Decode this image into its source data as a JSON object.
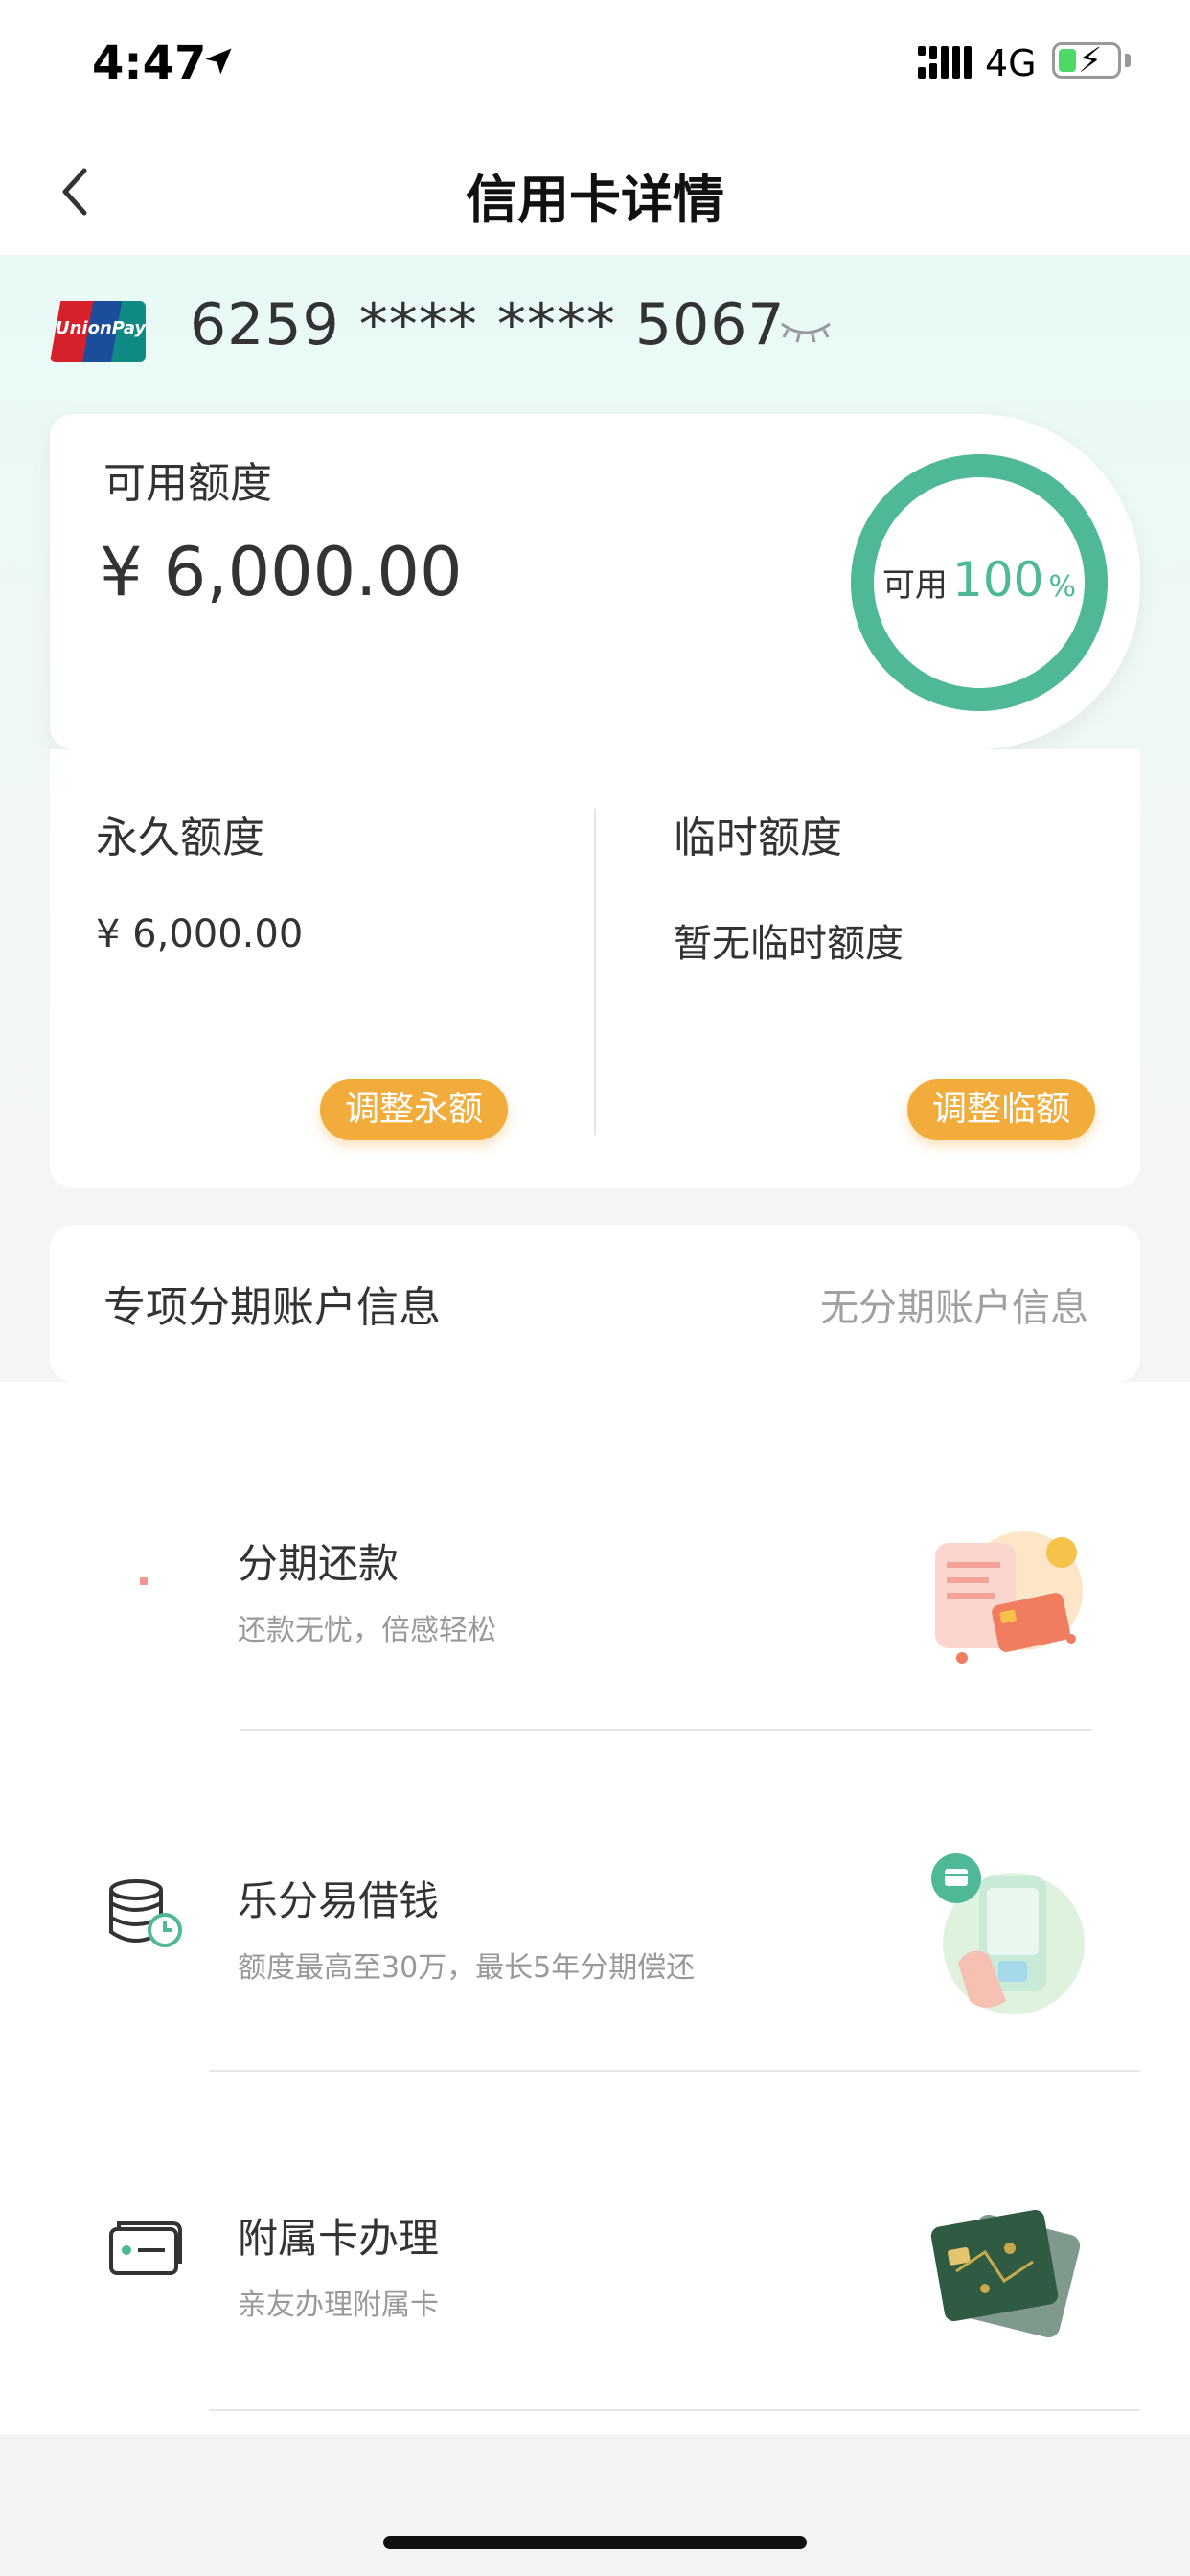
{
  "status_bar": {
    "time": "4:47",
    "network": "4G"
  },
  "nav": {
    "title": "信用卡详情"
  },
  "card": {
    "brand_logo_text": "UnionPay 银联",
    "number_masked": "6259 **** **** 5067"
  },
  "available": {
    "label": "可用额度",
    "amount": "¥ 6,000.00",
    "ring_label": "可用",
    "ring_percent": "100",
    "ring_percent_sign": "%",
    "ring_fraction": 1.0,
    "ring_color": "#4fb896"
  },
  "limits": {
    "permanent": {
      "title": "永久额度",
      "value": "¥ 6,000.00",
      "button": "调整永额"
    },
    "temporary": {
      "title": "临时额度",
      "value": "暂无临时额度",
      "button": "调整临额"
    },
    "button_color": "#f2ac3b"
  },
  "installment_account": {
    "label": "专项分期账户信息",
    "value": "无分期账户信息"
  },
  "services": [
    {
      "title": "分期还款",
      "subtitle": "还款无忧，倍感轻松",
      "icon": "installment-repay-icon"
    },
    {
      "title": "乐分易借钱",
      "subtitle": "额度最高至30万，最长5年分期偿还",
      "icon": "coins-clock-icon"
    },
    {
      "title": "附属卡办理",
      "subtitle": "亲友办理附属卡",
      "icon": "card-icon"
    }
  ]
}
